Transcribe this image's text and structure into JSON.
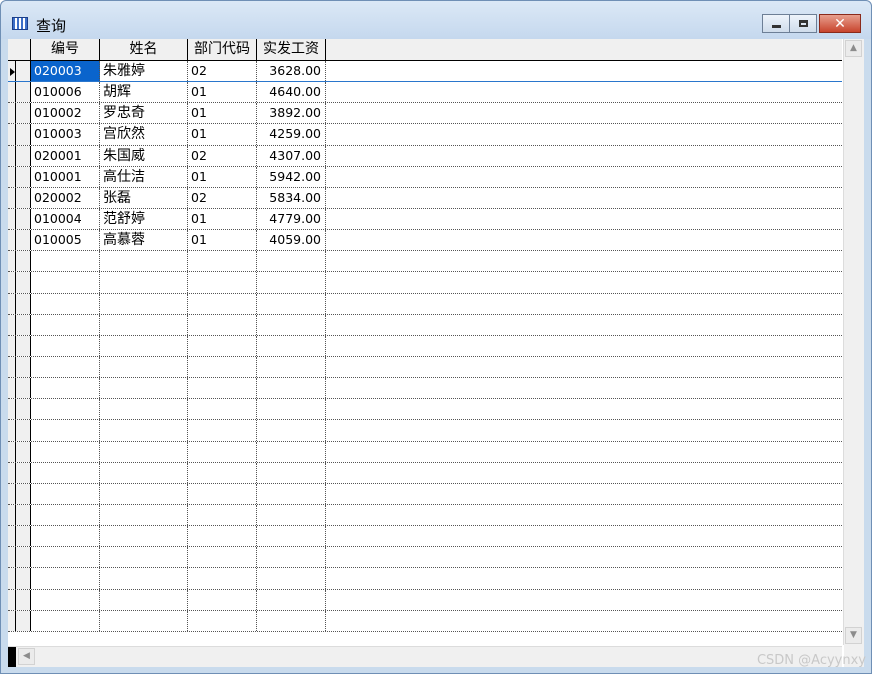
{
  "window": {
    "title": "查询"
  },
  "controls": {
    "minimize": "minimize",
    "maximize": "maximize",
    "close": "✕"
  },
  "columns": [
    "编号",
    "姓名",
    "部门代码",
    "实发工资"
  ],
  "rows": [
    {
      "id": "020003",
      "name": "朱雅婷",
      "dept": "02",
      "salary": "3628.00"
    },
    {
      "id": "010006",
      "name": "胡辉",
      "dept": "01",
      "salary": "4640.00"
    },
    {
      "id": "010002",
      "name": "罗忠奇",
      "dept": "01",
      "salary": "3892.00"
    },
    {
      "id": "010003",
      "name": "宫欣然",
      "dept": "01",
      "salary": "4259.00"
    },
    {
      "id": "020001",
      "name": "朱国威",
      "dept": "02",
      "salary": "4307.00"
    },
    {
      "id": "010001",
      "name": "高仕洁",
      "dept": "01",
      "salary": "5942.00"
    },
    {
      "id": "020002",
      "name": "张磊",
      "dept": "02",
      "salary": "5834.00"
    },
    {
      "id": "010004",
      "name": "范舒婷",
      "dept": "01",
      "salary": "4779.00"
    },
    {
      "id": "010005",
      "name": "高慕蓉",
      "dept": "01",
      "salary": "4059.00"
    }
  ],
  "selected_row": 0,
  "empty_rows": 18,
  "watermark": "CSDN @Acyynxy",
  "colors": {
    "selection": "#0a64cc",
    "titlebar": "#c5d8ee",
    "close": "#c7442d"
  }
}
